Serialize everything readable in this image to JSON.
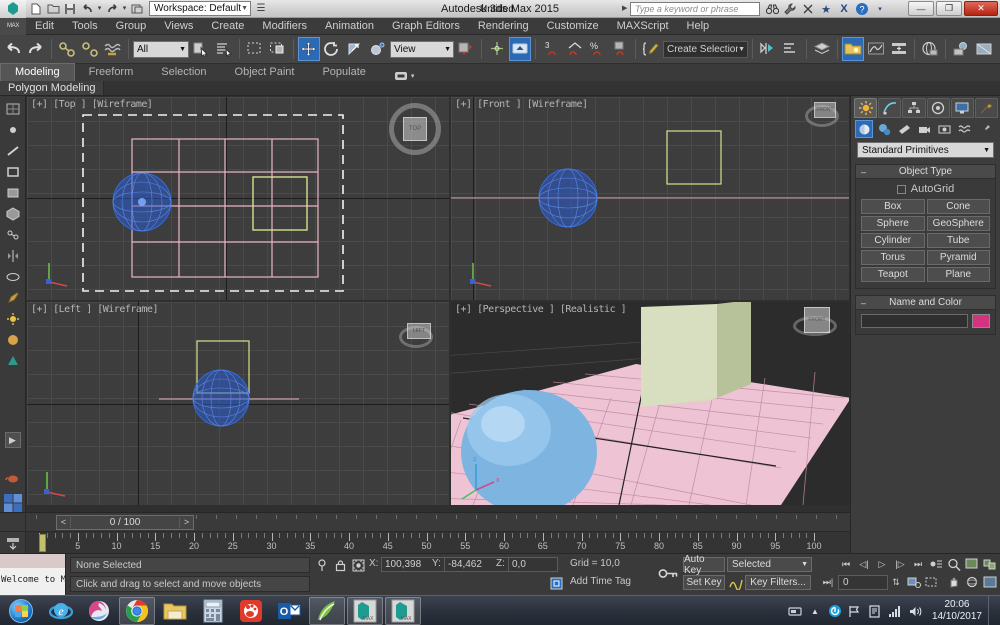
{
  "window": {
    "app_title": "Autodesk 3ds Max  2015",
    "document_name": "Untitled",
    "workspace_label": "Workspace: Default",
    "search_placeholder": "Type a keyword or phrase",
    "minimize_label": "—",
    "maximize_label": "❐",
    "close_label": "✕"
  },
  "menu": {
    "items": [
      {
        "label": "Edit"
      },
      {
        "label": "Tools"
      },
      {
        "label": "Group"
      },
      {
        "label": "Views"
      },
      {
        "label": "Create"
      },
      {
        "label": "Modifiers"
      },
      {
        "label": "Animation"
      },
      {
        "label": "Graph Editors"
      },
      {
        "label": "Rendering"
      },
      {
        "label": "Customize"
      },
      {
        "label": "MAXScript"
      },
      {
        "label": "Help"
      }
    ]
  },
  "toolbar": {
    "selection_filter_value": "All",
    "reference_coord_value": "View",
    "named_selection_set_value": "Create Selection Se",
    "angle_snap_value": "3",
    "percent_snap_value": "%"
  },
  "ribbon": {
    "tabs": [
      {
        "label": "Modeling",
        "active": true
      },
      {
        "label": "Freeform",
        "active": false
      },
      {
        "label": "Selection",
        "active": false
      },
      {
        "label": "Object Paint",
        "active": false
      },
      {
        "label": "Populate",
        "active": false
      }
    ],
    "panel_label": "Polygon Modeling"
  },
  "viewports": [
    {
      "label": "[+] [Top ] [Wireframe]",
      "name": "top",
      "selected": true
    },
    {
      "label": "[+] [Front ] [Wireframe]",
      "name": "front",
      "selected": false
    },
    {
      "label": "[+] [Left ] [Wireframe]",
      "name": "left",
      "selected": false
    },
    {
      "label": "[+] [Perspective ] [Realistic ]",
      "name": "perspective",
      "selected": false
    }
  ],
  "viewcube_labels": {
    "top": "TOP",
    "front": "FRONT",
    "left": "LEFT",
    "persp_top": "TOP",
    "persp_left": "LEFT",
    "persp_front": "FRONT"
  },
  "command_panel": {
    "tabs": [
      {
        "name": "create-tab",
        "icon": "sun-icon",
        "active": true
      },
      {
        "name": "modify-tab",
        "icon": "curve-icon",
        "active": false
      },
      {
        "name": "hierarchy-tab",
        "icon": "hierarchy-icon",
        "active": false
      },
      {
        "name": "motion-tab",
        "icon": "wheel-icon",
        "active": false
      },
      {
        "name": "display-tab",
        "icon": "monitor-icon",
        "active": false
      },
      {
        "name": "utilities-tab",
        "icon": "hammer-icon",
        "active": false
      }
    ],
    "category_value": "Standard Primitives",
    "object_type": {
      "title": "Object Type",
      "autogrid_label": "AutoGrid",
      "buttons": [
        "Box",
        "Cone",
        "Sphere",
        "GeoSphere",
        "Cylinder",
        "Tube",
        "Torus",
        "Pyramid",
        "Teapot",
        "Plane"
      ]
    },
    "name_and_color": {
      "title": "Name and Color",
      "name_value": "",
      "color_hex": "#d4337f"
    }
  },
  "time_slider": {
    "value": "0 / 100",
    "prev_label": "<",
    "next_label": ">"
  },
  "track_bar": {
    "ticks": [
      "5",
      "10",
      "15",
      "20",
      "25",
      "30",
      "35",
      "40",
      "45",
      "50",
      "55",
      "60",
      "65",
      "70",
      "75",
      "80",
      "85",
      "90",
      "95",
      "100"
    ],
    "key_frame": "0"
  },
  "status_bar": {
    "maxscript_mini_listener": "Welcome to M",
    "selection_status": "None Selected",
    "prompt_text": "Click and drag to select and move objects",
    "coords": {
      "x_label": "X:",
      "x_value": "100,398",
      "y_label": "Y:",
      "y_value": "-84,462",
      "z_label": "Z:",
      "z_value": "0,0"
    },
    "grid_label": "Grid = 10,0",
    "add_time_tag": "Add Time Tag",
    "auto_key_label": "Auto Key",
    "set_key_label": "Set Key",
    "key_mode_value": "Selected",
    "key_filters_label": "Key Filters...",
    "current_frame": "0"
  },
  "taskbar": {
    "items": [
      {
        "name": "internet-explorer-icon",
        "open": false
      },
      {
        "name": "firefox-icon",
        "open": false
      },
      {
        "name": "chrome-icon",
        "open": true
      },
      {
        "name": "file-explorer-icon",
        "open": false
      },
      {
        "name": "calculator-icon",
        "open": false
      },
      {
        "name": "media-player-icon",
        "open": false
      },
      {
        "name": "outlook-icon",
        "open": false
      },
      {
        "name": "sketch-app-icon",
        "open": true
      },
      {
        "name": "3dsmax-icon",
        "open": true
      },
      {
        "name": "3dsmax-icon-2",
        "open": true
      }
    ],
    "clock_time": "20:06",
    "clock_date": "14/10/2017"
  }
}
